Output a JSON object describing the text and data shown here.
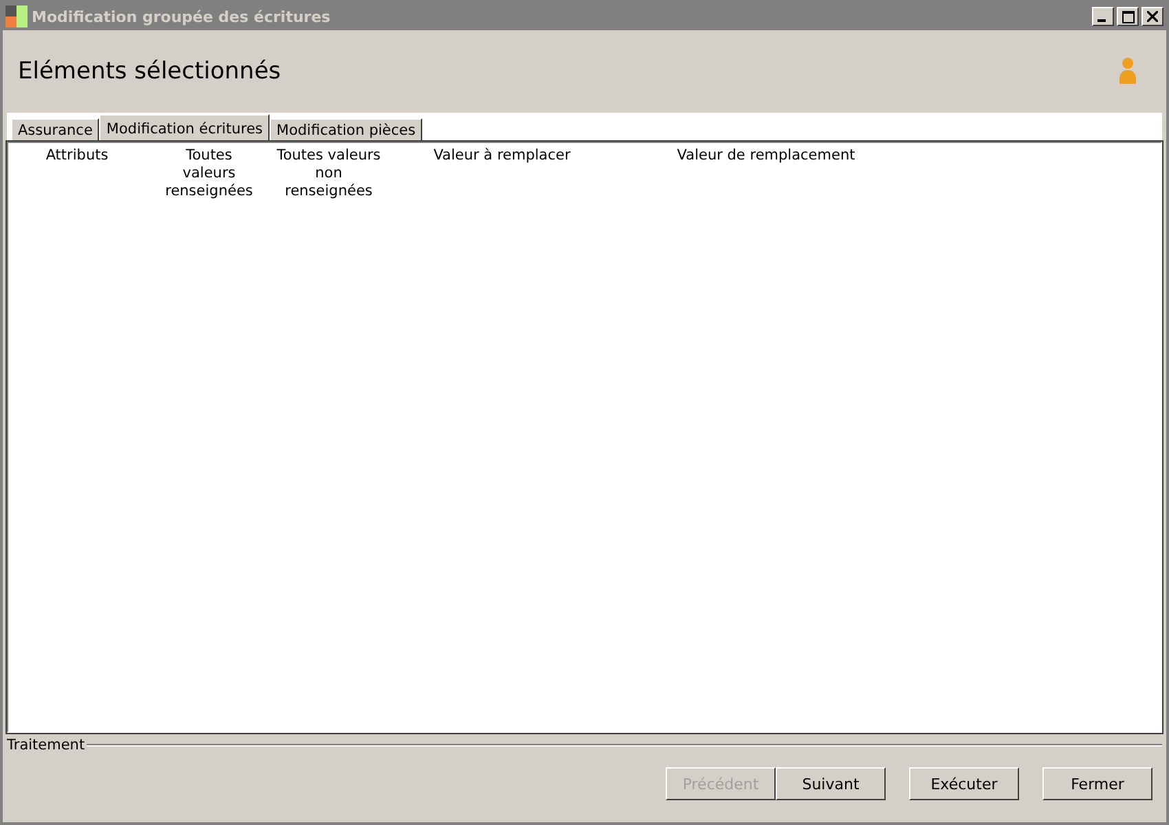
{
  "window": {
    "title": "Modification groupée des écritures"
  },
  "header": {
    "title": "Eléments sélectionnés"
  },
  "tabs": [
    {
      "label": "Assurance",
      "selected": false
    },
    {
      "label": "Modification écritures",
      "selected": true
    },
    {
      "label": "Modification pièces",
      "selected": false
    }
  ],
  "table": {
    "columns": [
      "Attributs",
      "Toutes valeurs renseignées",
      "Toutes valeurs non renseignées",
      "Valeur à remplacer",
      "Valeur de remplacement"
    ]
  },
  "group": {
    "label": "Traitement"
  },
  "buttons": [
    {
      "label": "Précédent",
      "disabled": true
    },
    {
      "label": "Suivant",
      "disabled": false
    },
    {
      "label": "Exécuter",
      "disabled": false
    },
    {
      "label": "Fermer",
      "disabled": false
    }
  ]
}
